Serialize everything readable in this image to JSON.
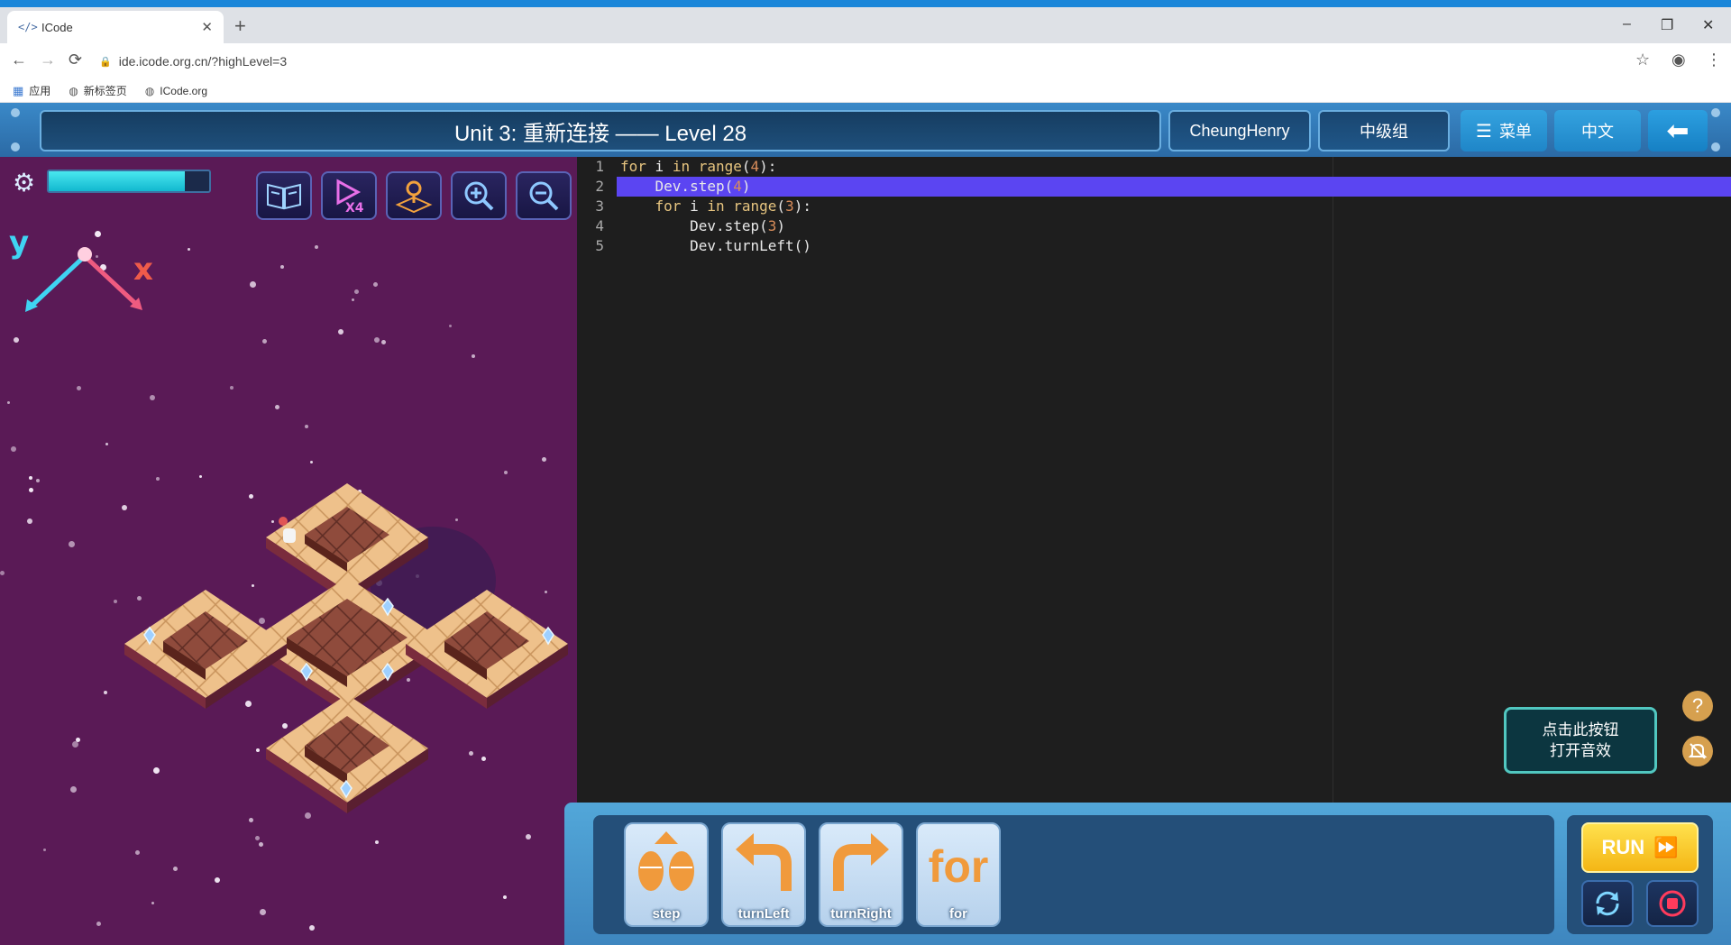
{
  "browser": {
    "tab_title": "ICode",
    "tab_close": "✕",
    "new_tab": "+",
    "url": "ide.icode.org.cn/?highLevel=3",
    "window_min": "–",
    "window_restore": "❐",
    "window_close": "✕",
    "bookmarks": [
      {
        "label": "应用"
      },
      {
        "label": "新标签页"
      },
      {
        "label": "ICode.org"
      }
    ]
  },
  "header": {
    "title": "Unit 3: 重新连接 —— Level 28",
    "user": "CheungHenry",
    "group": "中级组",
    "menu_label": "菜单",
    "lang_label": "中文"
  },
  "game": {
    "energy_fraction": 0.85,
    "axis_y": "y",
    "axis_x": "x"
  },
  "editor": {
    "lines": [
      {
        "n": "1",
        "text": "for i in range(4):"
      },
      {
        "n": "2",
        "text": "    Dev.step(4)"
      },
      {
        "n": "3",
        "text": "    for i in range(3):"
      },
      {
        "n": "4",
        "text": "        Dev.step(3)"
      },
      {
        "n": "5",
        "text": "        Dev.turnLeft()"
      }
    ],
    "highlighted_line": 2
  },
  "sound_hint": {
    "line1": "点击此按钮",
    "line2": "打开音效"
  },
  "blocks": [
    {
      "label": "step"
    },
    {
      "label": "turnLeft"
    },
    {
      "label": "turnRight"
    },
    {
      "label": "for"
    }
  ],
  "run_label": "RUN",
  "colors": {
    "header_blue": "#2b6aa5",
    "game_bg": "#5a1a56",
    "highlight": "#5b45f2",
    "run_yellow": "#f4b615"
  }
}
